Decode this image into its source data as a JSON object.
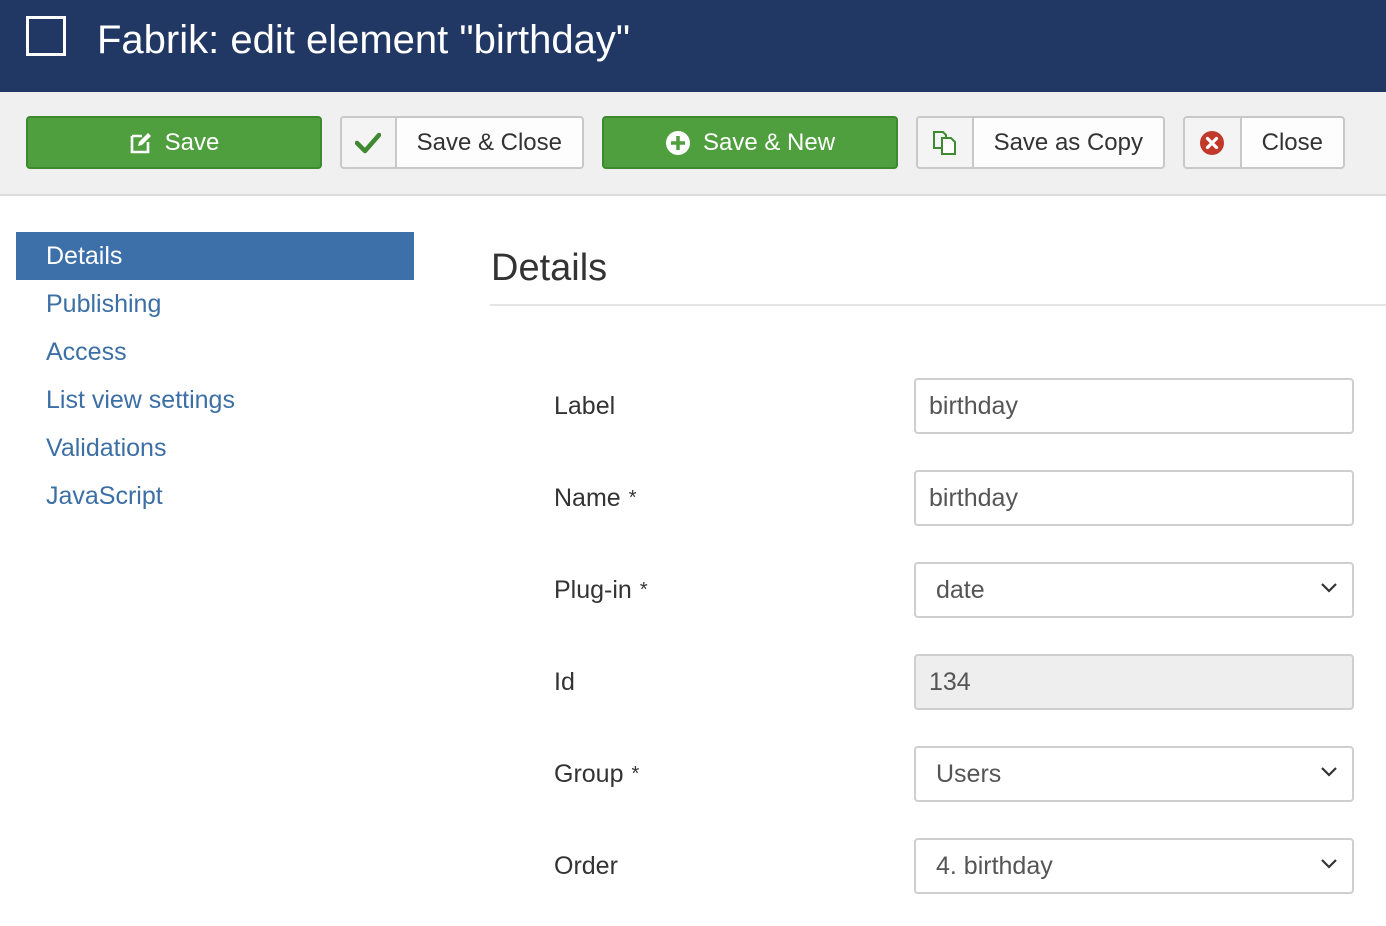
{
  "header": {
    "title": "Fabrik: edit element \"birthday\""
  },
  "toolbar": {
    "save": "Save",
    "save_close": "Save & Close",
    "save_new": "Save & New",
    "save_copy": "Save as Copy",
    "close": "Close"
  },
  "sidebar": {
    "items": [
      {
        "label": "Details",
        "active": true
      },
      {
        "label": "Publishing"
      },
      {
        "label": "Access"
      },
      {
        "label": "List view settings"
      },
      {
        "label": "Validations"
      },
      {
        "label": "JavaScript"
      }
    ]
  },
  "main": {
    "heading": "Details",
    "fields": {
      "label": {
        "label": "Label",
        "value": "birthday"
      },
      "name": {
        "label": "Name",
        "required": "*",
        "value": "birthday"
      },
      "plugin": {
        "label": "Plug-in",
        "required": "*",
        "value": "date"
      },
      "id": {
        "label": "Id",
        "value": "134"
      },
      "group": {
        "label": "Group",
        "required": "*",
        "value": "Users"
      },
      "order": {
        "label": "Order",
        "value": "4. birthday"
      }
    }
  },
  "colors": {
    "header_bg": "#213764",
    "primary_green": "#4f9f3f",
    "nav_active": "#3d6fa8",
    "link": "#3c6fa5",
    "danger": "#c0392b"
  },
  "icons": [
    "checkbox-icon",
    "edit-icon",
    "check-icon",
    "plus-circle-icon",
    "copy-icon",
    "close-circle-icon",
    "chevron-down-icon"
  ]
}
